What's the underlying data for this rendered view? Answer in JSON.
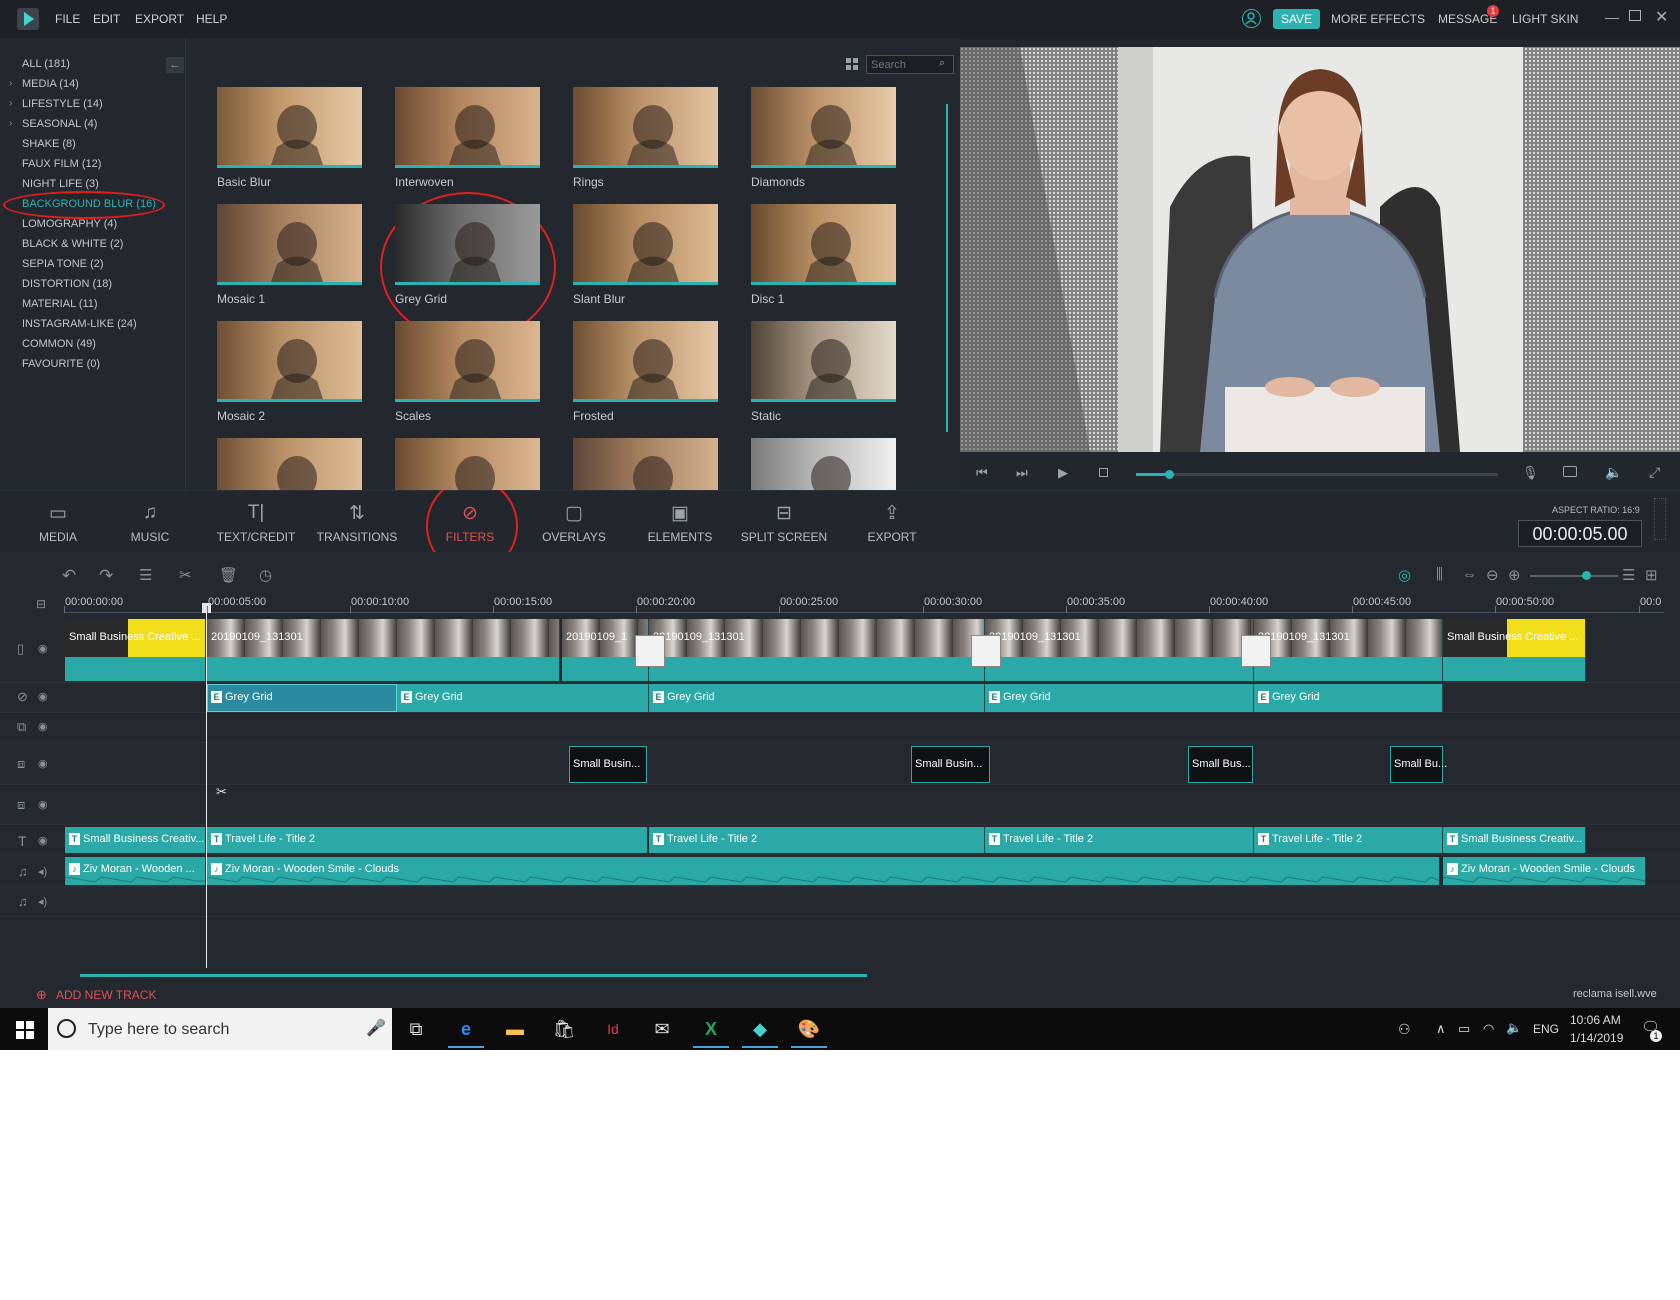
{
  "menu": {
    "items": [
      "FILE",
      "EDIT",
      "EXPORT",
      "HELP"
    ],
    "save": "SAVE",
    "more_effects": "MORE EFFECTS",
    "message": "MESSAGE",
    "message_count": "1",
    "light_skin": "LIGHT SKIN",
    "icons": [
      "account-icon",
      "minimize-icon",
      "restore-icon",
      "close-icon"
    ]
  },
  "sidebar": {
    "categories": [
      {
        "label": "ALL (181)",
        "expandable": false
      },
      {
        "label": "MEDIA (14)",
        "expandable": true
      },
      {
        "label": "LIFESTYLE (14)",
        "expandable": true
      },
      {
        "label": "SEASONAL (4)",
        "expandable": true
      },
      {
        "label": "SHAKE (8)",
        "expandable": false
      },
      {
        "label": "FAUX FILM (12)",
        "expandable": false
      },
      {
        "label": "NIGHT LIFE (3)",
        "expandable": false
      },
      {
        "label": "BACKGROUND BLUR (16)",
        "expandable": false,
        "selected": true
      },
      {
        "label": "LOMOGRAPHY (4)",
        "expandable": false
      },
      {
        "label": "BLACK & WHITE (2)",
        "expandable": false
      },
      {
        "label": "SEPIA TONE (2)",
        "expandable": false
      },
      {
        "label": "DISTORTION (18)",
        "expandable": false
      },
      {
        "label": "MATERIAL (11)",
        "expandable": false
      },
      {
        "label": "INSTAGRAM-LIKE (24)",
        "expandable": false
      },
      {
        "label": "COMMON (49)",
        "expandable": false
      },
      {
        "label": "FAVOURITE (0)",
        "expandable": false
      }
    ],
    "collapse_icon": "arrow-left-icon"
  },
  "search": {
    "placeholder": "Search"
  },
  "filters": [
    {
      "label": "Basic Blur"
    },
    {
      "label": "Interwoven"
    },
    {
      "label": "Rings"
    },
    {
      "label": "Diamonds"
    },
    {
      "label": "Mosaic 1"
    },
    {
      "label": "Grey Grid"
    },
    {
      "label": "Slant Blur"
    },
    {
      "label": "Disc 1"
    },
    {
      "label": "Mosaic 2"
    },
    {
      "label": "Scales"
    },
    {
      "label": "Frosted"
    },
    {
      "label": "Static"
    },
    {
      "label": ""
    },
    {
      "label": ""
    },
    {
      "label": ""
    },
    {
      "label": ""
    }
  ],
  "preview_controls": {
    "playback_progress": 0.09,
    "icons": [
      "skip-back-icon",
      "step-forward-icon",
      "play-icon",
      "stop-icon",
      "mic-icon",
      "camera-icon",
      "volume-icon",
      "fullscreen-icon"
    ]
  },
  "toolbar": {
    "tools": [
      {
        "label": "MEDIA",
        "icon": "folder-icon"
      },
      {
        "label": "MUSIC",
        "icon": "music-icon"
      },
      {
        "label": "TEXT/CREDIT",
        "icon": "text-icon"
      },
      {
        "label": "TRANSITIONS",
        "icon": "transitions-icon"
      },
      {
        "label": "FILTERS",
        "icon": "filters-icon"
      },
      {
        "label": "OVERLAYS",
        "icon": "overlays-icon"
      },
      {
        "label": "ELEMENTS",
        "icon": "elements-icon"
      },
      {
        "label": "SPLIT SCREEN",
        "icon": "split-screen-icon"
      },
      {
        "label": "EXPORT",
        "icon": "export-icon"
      }
    ],
    "aspect_ratio": "ASPECT RATIO: 16:9",
    "timecode": "00:00:05.00"
  },
  "timeline": {
    "ruler": [
      "00:00:00:00",
      "00:00:05:00",
      "00:00:10:00",
      "00:00:15:00",
      "00:00:20:00",
      "00:00:25:00",
      "00:00:30:00",
      "00:00:35:00",
      "00:00:40:00",
      "00:00:45:00",
      "00:00:50:00",
      "00:0"
    ],
    "video_clips": [
      "Small Business Creative ...",
      "20190109_131301",
      "20190109_1",
      "20190109_131301",
      "20190109_131301",
      "20190109_131301",
      "Small Business Creative ..."
    ],
    "filter_clips": [
      "Grey Grid",
      "Grey Grid",
      "Grey Grid",
      "Grey Grid",
      "Grey Grid"
    ],
    "element_clips": [
      "Small Busin...",
      "Small Busin...",
      "Small Bus...",
      "Small Bu..."
    ],
    "title_clips": [
      "Small Business Creativ...",
      "Travel Life - Title 2",
      "Travel Life - Title 2",
      "Travel Life - Title 2",
      "Travel Life - Title 2",
      "Small Business Creativ..."
    ],
    "audio_clips": [
      "Ziv Moran - Wooden ...",
      "Ziv Moran - Wooden Smile - Clouds",
      "Ziv Moran - Wooden Smile - Clouds"
    ],
    "add_track": "ADD NEW TRACK",
    "project_name": "reclama isell.wve"
  },
  "taskbar": {
    "search_placeholder": "Type here to search",
    "language": "ENG",
    "time": "10:06 AM",
    "date": "1/14/2019",
    "notification_count": "1"
  },
  "colors": {
    "accent": "#2bb3b3",
    "clip": "#2aa9a6",
    "annotation": "#e0201f",
    "background": "#22272d"
  }
}
